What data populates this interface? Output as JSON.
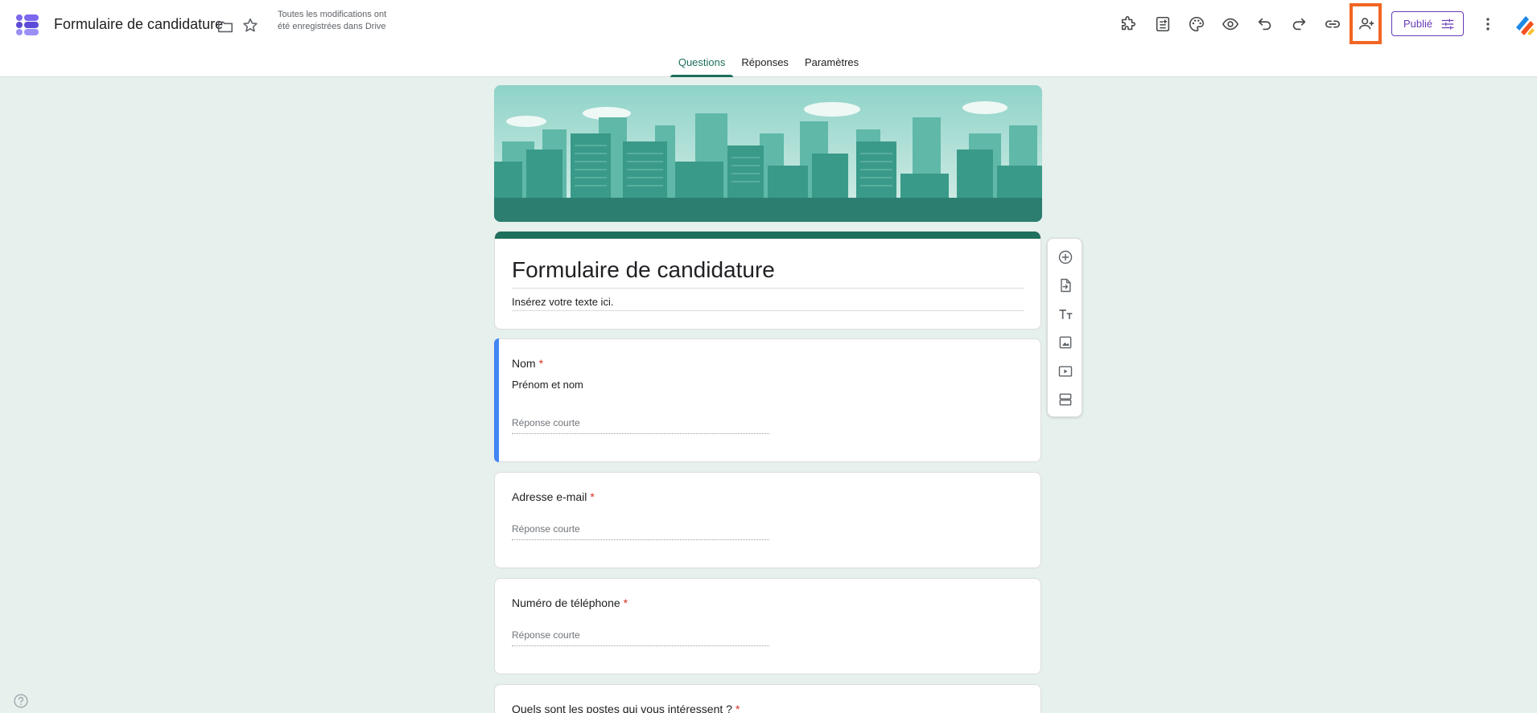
{
  "header": {
    "doc_title": "Formulaire de candidature",
    "save_status": "Toutes les modifications ont été enregistrées dans Drive",
    "publish_label": "Publié"
  },
  "tabs": [
    {
      "label": "Questions",
      "active": true
    },
    {
      "label": "Réponses",
      "active": false
    },
    {
      "label": "Paramètres",
      "active": false
    }
  ],
  "form": {
    "title": "Formulaire de candidature",
    "description": "Insérez votre texte ici."
  },
  "questions": [
    {
      "title": "Nom",
      "required_mark": "*",
      "description": "Prénom et nom",
      "answer_placeholder": "Réponse courte"
    },
    {
      "title": "Adresse e-mail",
      "required_mark": "*",
      "answer_placeholder": "Réponse courte"
    },
    {
      "title": "Numéro de téléphone",
      "required_mark": "*",
      "answer_placeholder": "Réponse courte"
    },
    {
      "title": "Quels sont les postes qui vous intéressent ?",
      "required_mark": "*"
    }
  ],
  "icons": {
    "toolbar": [
      "addons-icon",
      "form-content-icon",
      "palette-icon",
      "preview-icon",
      "undo-icon",
      "redo-icon",
      "link-icon",
      "add-collaborator-icon"
    ],
    "side": [
      "add-question-icon",
      "import-questions-icon",
      "add-title-icon",
      "add-image-icon",
      "add-video-icon",
      "add-section-icon"
    ]
  },
  "colors": {
    "accent": "#1e6f5c",
    "background": "#e6f0ec",
    "selection": "#4285f4",
    "publish": "#673ab7",
    "highlight": "#f26522",
    "required": "#d93025"
  }
}
